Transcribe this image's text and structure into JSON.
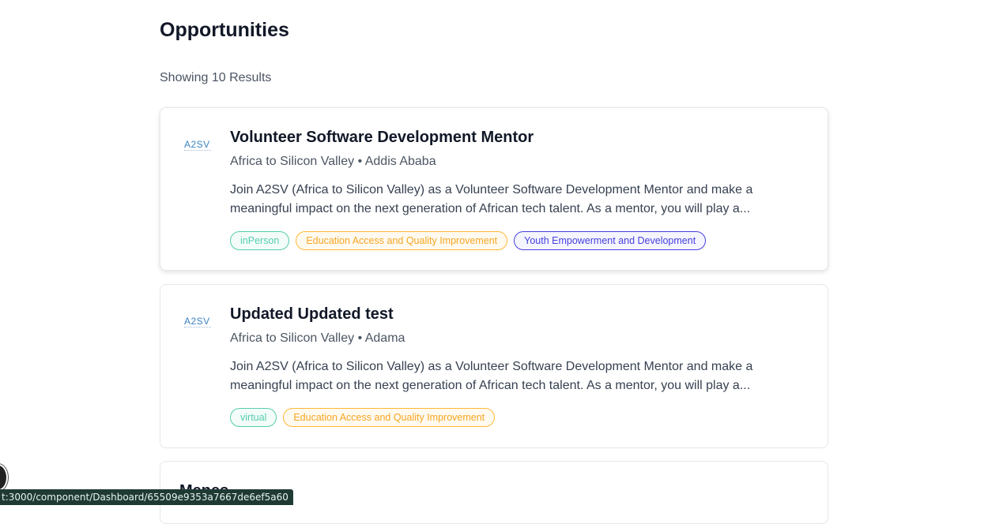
{
  "page": {
    "title": "Opportunities",
    "results_text": "Showing 10 Results"
  },
  "opportunities": [
    {
      "logo_text": "A2SV",
      "title": "Volunteer Software Development Mentor",
      "company": "Africa to Silicon Valley",
      "separator": "•",
      "location": "Addis Ababa",
      "description_line1": "Join A2SV (Africa to Silicon Valley) as a Volunteer Software Development Mentor and make a",
      "description_line2": "meaningful impact on the next generation of African tech talent. As a mentor, you will play a...",
      "tags": [
        "inPerson",
        "Education Access and Quality Improvement",
        "Youth Empowerment and Development"
      ]
    },
    {
      "logo_text": "A2SV",
      "title": "Updated Updated test",
      "company": "Africa to Silicon Valley",
      "separator": "•",
      "location": "Adama",
      "description_line1": "Join A2SV (Africa to Silicon Valley) as a Volunteer Software Development Mentor and make a",
      "description_line2": "meaningful impact on the next generation of African tech talent. As a mentor, you will play a...",
      "tags": [
        "virtual",
        "Education Access and Quality Improvement"
      ]
    },
    {
      "title": "Menes"
    }
  ],
  "status_bar": {
    "url": "t:3000/component/Dashboard/65509e9353a7667de6ef5a60"
  },
  "colors": {
    "tag_green": "#56cdad",
    "tag_orange": "#ffb836",
    "tag_indigo": "#4640de"
  }
}
